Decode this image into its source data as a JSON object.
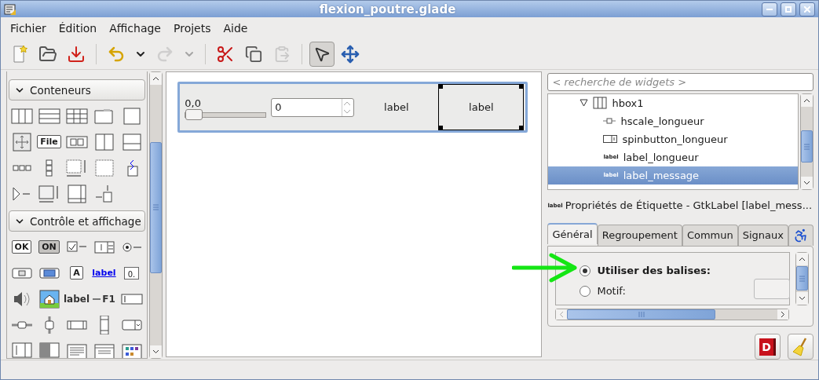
{
  "window": {
    "title": "flexion_poutre.glade"
  },
  "menu": [
    "Fichier",
    "Édition",
    "Affichage",
    "Projets",
    "Aide"
  ],
  "toolbar": [
    {
      "kind": "new",
      "disabled": false,
      "selected": false
    },
    {
      "kind": "open",
      "disabled": false,
      "selected": false
    },
    {
      "kind": "save",
      "disabled": false,
      "selected": false
    },
    {
      "kind": "separator"
    },
    {
      "kind": "undo",
      "disabled": false,
      "selected": false
    },
    {
      "kind": "dropdown",
      "disabled": false,
      "selected": false
    },
    {
      "kind": "redo",
      "disabled": true,
      "selected": false
    },
    {
      "kind": "dropdown",
      "disabled": true,
      "selected": false
    },
    {
      "kind": "separator"
    },
    {
      "kind": "cut",
      "disabled": false,
      "selected": false
    },
    {
      "kind": "copy",
      "disabled": false,
      "selected": false
    },
    {
      "kind": "paste",
      "disabled": true,
      "selected": false
    },
    {
      "kind": "separator"
    },
    {
      "kind": "pointer",
      "disabled": false,
      "selected": true
    },
    {
      "kind": "move",
      "disabled": false,
      "selected": false
    }
  ],
  "palette": {
    "sections": [
      {
        "title": "Conteneurs",
        "expanded": true,
        "items": [
          {
            "kind": "columns"
          },
          {
            "kind": "rows"
          },
          {
            "kind": "grid"
          },
          {
            "kind": "folder-tab"
          },
          {
            "kind": "square"
          },
          {
            "kind": "cross-arrows"
          },
          {
            "kind": "framed-text",
            "text": "File"
          },
          {
            "kind": "two-boxes"
          },
          {
            "kind": "split-vertical"
          },
          {
            "kind": "split-horizontal"
          },
          {
            "kind": "dots-row"
          },
          {
            "kind": "dots-column"
          },
          {
            "kind": "dotted-box-arrows"
          },
          {
            "kind": "dotted-box"
          },
          {
            "kind": "zigzag-box"
          },
          {
            "kind": "triangle-dash"
          },
          {
            "kind": "box-arrows"
          },
          {
            "kind": "box-scrollbars"
          },
          {
            "kind": "arrow-box"
          }
        ]
      },
      {
        "title": "Contrôle et affichage",
        "expanded": true,
        "items": [
          {
            "kind": "text-button",
            "text": "OK"
          },
          {
            "kind": "pressed-button",
            "text": "ON"
          },
          {
            "kind": "check-dash"
          },
          {
            "kind": "spin-box"
          },
          {
            "kind": "radio-dash"
          },
          {
            "kind": "folder-button"
          },
          {
            "kind": "rect-button"
          },
          {
            "kind": "text-button",
            "text": "A"
          },
          {
            "kind": "link-text",
            "text": "label"
          },
          {
            "kind": "value-box",
            "text": "0."
          },
          {
            "kind": "speaker"
          },
          {
            "kind": "house-picture"
          },
          {
            "kind": "bold-text",
            "text": "label"
          },
          {
            "kind": "dash-text",
            "text": "F1"
          },
          {
            "kind": "entry"
          },
          {
            "kind": "hslider"
          },
          {
            "kind": "vslider"
          },
          {
            "kind": "hscrollbar"
          },
          {
            "kind": "vscrollbar"
          },
          {
            "kind": "combo"
          },
          {
            "kind": "combo-entry"
          },
          {
            "kind": "progress"
          },
          {
            "kind": "text-lines"
          },
          {
            "kind": "window-lines"
          },
          {
            "kind": "color-grid"
          }
        ]
      }
    ]
  },
  "canvas": {
    "scale": {
      "reading": "0,0",
      "level": 0
    },
    "spin": {
      "value": "0"
    },
    "labels": [
      {
        "text": "label",
        "selected": false
      },
      {
        "text": "label",
        "selected": true
      }
    ]
  },
  "search": {
    "placeholder": "< recherche de widgets >"
  },
  "tree": [
    {
      "label": "hbox1",
      "kind": "box",
      "expanded": true,
      "selected": false,
      "children": [
        {
          "label": "hscale_longueur",
          "kind": "scale",
          "selected": false
        },
        {
          "label": "spinbutton_longueur",
          "kind": "spin",
          "selected": false
        },
        {
          "label": "label_longueur",
          "kind": "text",
          "icon_text": "label",
          "selected": false
        },
        {
          "label": "label_message",
          "kind": "text",
          "icon_text": "label",
          "selected": true
        }
      ]
    }
  ],
  "properties": {
    "icon_text": "label",
    "title": "Propriétés de Étiquette - GtkLabel [label_mess...",
    "tabs": [
      {
        "kind": "text",
        "label": "Général",
        "selected": true
      },
      {
        "kind": "text",
        "label": "Regroupement",
        "selected": false
      },
      {
        "kind": "text",
        "label": "Commun",
        "selected": false
      },
      {
        "kind": "text",
        "label": "Signaux",
        "selected": false
      },
      {
        "kind": "accessibility",
        "selected": false
      }
    ],
    "options": [
      {
        "label": "Utiliser des balises:",
        "selected": true
      },
      {
        "label": "Motif:",
        "selected": false
      }
    ]
  },
  "actions": [
    {
      "kind": "book",
      "text": "D"
    },
    {
      "kind": "broom"
    }
  ]
}
